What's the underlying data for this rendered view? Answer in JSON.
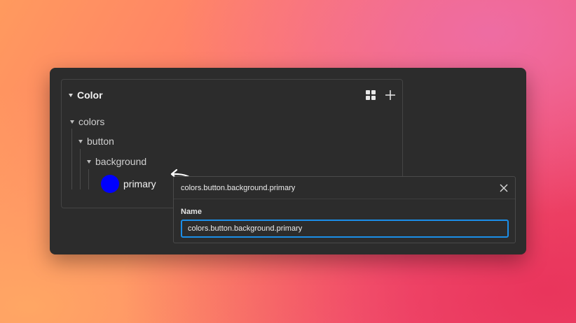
{
  "panel": {
    "title": "Color",
    "actions": {
      "grid_icon": "grid-view-icon",
      "add_icon": "plus-icon"
    }
  },
  "tree": {
    "group1": "colors",
    "group2": "button",
    "group3": "background",
    "token": {
      "label": "primary",
      "color": "#0000ff"
    }
  },
  "dialog": {
    "title": "colors.button.background.primary",
    "name_label": "Name",
    "name_value": "colors.button.background.primary",
    "close_icon": "close-icon"
  },
  "colors": {
    "window_bg": "#2c2c2c",
    "input_focus": "#1b8ee8"
  }
}
